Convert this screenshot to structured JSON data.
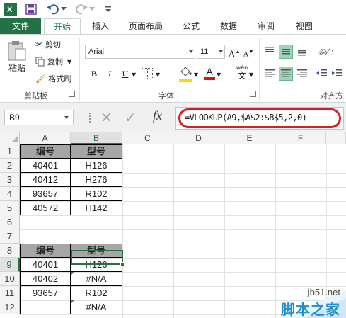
{
  "app": {
    "accent": "#217346",
    "annotation_color": "#d42020"
  },
  "qat": {
    "excel_icon": "excel-logo-icon",
    "save_icon": "save-icon",
    "undo_icon": "undo-icon",
    "redo_icon": "redo-icon"
  },
  "tabs": [
    {
      "label": "文件"
    },
    {
      "label": "开始"
    },
    {
      "label": "插入"
    },
    {
      "label": "页面布局"
    },
    {
      "label": "公式"
    },
    {
      "label": "数据"
    },
    {
      "label": "审阅"
    },
    {
      "label": "视图"
    }
  ],
  "ribbon": {
    "clipboard": {
      "paste": "粘贴",
      "cut": "剪切",
      "copy": "复制",
      "format_painter": "格式刷",
      "group_label": "剪贴板"
    },
    "font": {
      "name": "Arial",
      "size": "11",
      "bold": "B",
      "italic": "I",
      "underline": "U",
      "grow": "A",
      "shrink": "A",
      "color": "A",
      "phonetic": "wén",
      "group_label": "字体"
    },
    "alignment": {
      "group_label": "对齐方"
    }
  },
  "formula_bar": {
    "name_box": "B9",
    "fx": "fx",
    "formula": "=VLOOKUP(A9,$A$2:$B$5,2,0)"
  },
  "sheet": {
    "columns": [
      "A",
      "B",
      "C",
      "D",
      "E",
      "F"
    ],
    "rows": [
      "1",
      "2",
      "3",
      "4",
      "5",
      "6",
      "7",
      "8",
      "9",
      "10",
      "11",
      "12"
    ],
    "table1": {
      "header": [
        "编号",
        "型号"
      ],
      "rows": [
        [
          "40401",
          "H126"
        ],
        [
          "40412",
          "H276"
        ],
        [
          "93657",
          "R102"
        ],
        [
          "40572",
          "H142"
        ]
      ]
    },
    "table2": {
      "header": [
        "编号",
        "型号"
      ],
      "rows": [
        [
          "40401",
          "H126"
        ],
        [
          "40402",
          "#N/A"
        ],
        [
          "93657",
          "R102"
        ],
        [
          "",
          "#N/A"
        ]
      ]
    }
  },
  "watermark": {
    "url": "jb51.net",
    "text": "脚本之家"
  }
}
